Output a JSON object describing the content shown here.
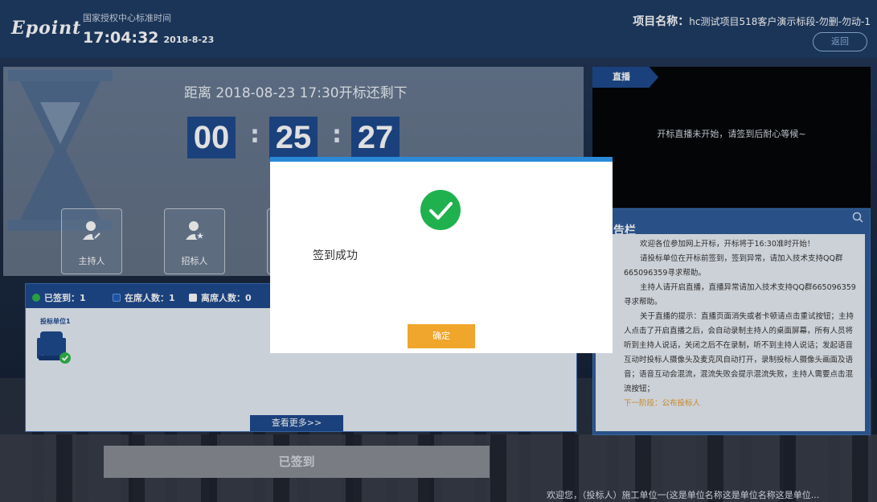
{
  "header": {
    "logo": "Epoint",
    "clock_label": "国家授权中心标准时间",
    "time": "17:04:32",
    "date": "2018-8-23",
    "project_label": "项目名称：",
    "project_name": "hc测试项目518客户演示标段-勿删-勿动-1",
    "back_label": "返回"
  },
  "countdown": {
    "title": "距离 2018-08-23 17:30开标还剩下",
    "hours": "00",
    "minutes": "25",
    "seconds": "27",
    "separator": ":"
  },
  "roles": [
    {
      "label": "主持人",
      "icon": "host-icon"
    },
    {
      "label": "招标人",
      "icon": "tenderee-icon"
    }
  ],
  "checkin": {
    "signed": "已签到：1",
    "present": "在席人数：1",
    "absent": "离席人数：0",
    "seat_label": "投标单位1",
    "more_label": "查看更多>>",
    "colors": {
      "signed": "#2fb54a",
      "present": "#1e5fc0",
      "absent": "#ffffff"
    }
  },
  "signed_button": "已签到",
  "live": {
    "tag": "直播",
    "message": "开标直播未开始，请签到后耐心等候~"
  },
  "notice": {
    "title": "告栏",
    "paragraphs": [
      "欢迎各位参加网上开标，开标将于16:30准时开始！",
      "请投标单位在开标前签到，签到异常，请加入技术支持QQ群665096359寻求帮助。",
      "主持人请开启直播，直播异常请加入技术支持QQ群665096359寻求帮助。",
      "关于直播的提示：直播页面消失或者卡顿请点击重试按钮；主持人点击了开启直播之后，会自动录制主持人的桌面屏幕，所有人员将听到主持人说话，关闭之后不在录制，听不到主持人说话；发起语音互动时投标人摄像头及麦克风自动打开，录制投标人摄像头画面及语音；语音互动会混流，混流失败会提示混流失败，主持人需要点击混流按钮；"
    ],
    "next_stage": "下一阶段：公布投标人"
  },
  "footer": "欢迎您，（投标人）施工单位一(这是单位名称这是单位名称这是单位...",
  "modal": {
    "message": "签到成功",
    "ok_label": "确定",
    "icon": "success-check-icon",
    "accent": "#2a8ad8",
    "success_color": "#1fb14d"
  }
}
